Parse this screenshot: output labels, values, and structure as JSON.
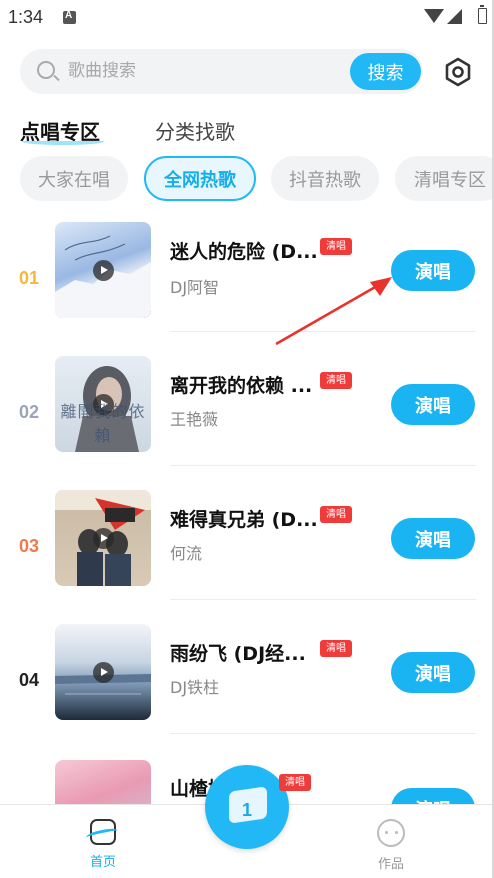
{
  "status_bar": {
    "time": "1:34"
  },
  "search": {
    "placeholder": "歌曲搜索",
    "button_label": "搜索"
  },
  "main_tabs": [
    {
      "label": "点唱专区",
      "active": true
    },
    {
      "label": "分类找歌",
      "active": false
    }
  ],
  "chips": [
    {
      "label": "大家在唱",
      "active": false
    },
    {
      "label": "全网热歌",
      "active": true
    },
    {
      "label": "抖音热歌",
      "active": false
    },
    {
      "label": "清唱专区",
      "active": false
    }
  ],
  "badge_label": "清唱",
  "sing_label": "演唱",
  "songs": [
    {
      "rank": "01",
      "rank_color": "#f4b83c",
      "title": "迷人的危险 (D...",
      "artist": "DJ阿智",
      "cover_text": ""
    },
    {
      "rank": "02",
      "rank_color": "#9aa6b8",
      "title": "离开我的依赖 ...",
      "artist": "王艳薇",
      "cover_text": "離開我的依賴"
    },
    {
      "rank": "03",
      "rank_color": "#f27a4a",
      "title": "难得真兄弟 (D...",
      "artist": "何流",
      "cover_text": "难得真兄弟"
    },
    {
      "rank": "04",
      "rank_color": "#222222",
      "title": "雨纷飞 (DJ经...",
      "artist": "DJ铁柱",
      "cover_text": ""
    },
    {
      "rank": "",
      "rank_color": "#222222",
      "title": "山楂树",
      "artist": "",
      "cover_text": ""
    }
  ],
  "bottom_nav": {
    "home_label": "首页",
    "works_label": "作品",
    "fab_count": "1"
  },
  "colors": {
    "accent": "#22b8f5",
    "badge": "#f03b3b"
  }
}
